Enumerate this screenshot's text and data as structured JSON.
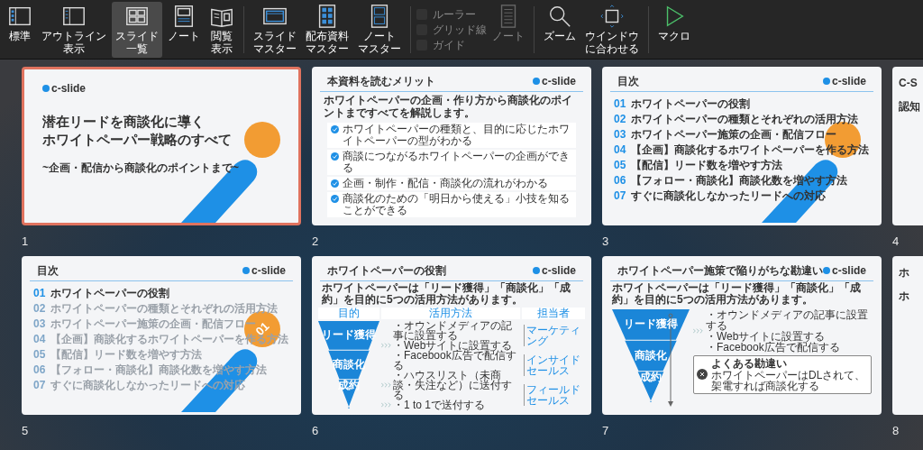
{
  "toolbar": {
    "groups": [
      {
        "items": [
          {
            "kind": "normal",
            "label": [
              "標準"
            ],
            "selected": false
          },
          {
            "kind": "outline",
            "label": [
              "アウトライン",
              "表示"
            ],
            "selected": false
          },
          {
            "kind": "sorter",
            "label": [
              "スライド",
              "一覧"
            ],
            "selected": true
          },
          {
            "kind": "notes",
            "label": [
              "ノート"
            ],
            "selected": false
          },
          {
            "kind": "reading",
            "label": [
              "閲覧",
              "表示"
            ],
            "selected": false
          }
        ]
      },
      {
        "items": [
          {
            "kind": "slide_master",
            "label": [
              "スライド",
              "マスター"
            ]
          },
          {
            "kind": "handout_master",
            "label": [
              "配布資料",
              "マスター"
            ]
          },
          {
            "kind": "notes_master",
            "label": [
              "ノート",
              "マスター"
            ]
          }
        ]
      },
      {
        "items": [
          {
            "kind": "checkboxes",
            "options": [
              {
                "label": "ルーラー",
                "checked": false,
                "disabled": true
              },
              {
                "label": "グリッド線",
                "checked": false,
                "disabled": true
              },
              {
                "label": "ガイド",
                "checked": false,
                "disabled": true
              }
            ]
          },
          {
            "kind": "notes_page",
            "label": [
              "ノート"
            ],
            "disabled": true
          }
        ]
      },
      {
        "items": [
          {
            "kind": "zoom",
            "label": [
              "ズーム"
            ]
          },
          {
            "kind": "fit",
            "label": [
              "ウインドウ",
              "に合わせる"
            ]
          }
        ]
      },
      {
        "items": [
          {
            "kind": "macro",
            "label": [
              "マクロ"
            ]
          }
        ]
      }
    ]
  },
  "slides": [
    {
      "number": "1",
      "selected": true,
      "kind": "title",
      "logo": "c-slide",
      "title": [
        "潜在リードを商談化に導く",
        "ホワイトペーパー戦略のすべて"
      ],
      "subtitle": "~企画・配信から商談化のポイントまで~"
    },
    {
      "number": "2",
      "selected": false,
      "kind": "benefits",
      "title": "本資料を読むメリット",
      "logo": "c-slide",
      "lead": "ホワイトペーパーの企画・作り方から商談化のポイントまですべてを解説します。",
      "points": [
        "ホワイトペーパーの種類と、目的に応じたホワイトペーパーの型がわかる",
        "商談につながるホワイトペーパーの企画ができる",
        "企画・制作・配信・商談化の流れがわかる",
        "商談化のための「明日から使える」小技を知ることができる"
      ]
    },
    {
      "number": "3",
      "selected": false,
      "kind": "toc",
      "title": "目次",
      "logo": "c-slide",
      "items": [
        {
          "num": "01",
          "text": "ホワイトペーパーの役割",
          "active": true
        },
        {
          "num": "02",
          "text": "ホワイトペーパーの種類とそれぞれの活用方法",
          "active": true
        },
        {
          "num": "03",
          "text": "ホワイトペーパー施策の企画・配信フロー",
          "active": true
        },
        {
          "num": "04",
          "text": "【企画】商談化するホワイトペーパーを作る方法",
          "active": true
        },
        {
          "num": "05",
          "text": "【配信】リード数を増やす方法",
          "active": true
        },
        {
          "num": "06",
          "text": "【フォロー・商談化】商談化数を増やす方法",
          "active": true
        },
        {
          "num": "07",
          "text": "すぐに商談化しなかったリードへの対応",
          "active": true
        }
      ]
    },
    {
      "number": "4",
      "selected": false,
      "kind": "partial",
      "title": "C-S",
      "lead": "認知"
    },
    {
      "number": "5",
      "selected": false,
      "kind": "toc",
      "title": "目次",
      "logo": "c-slide",
      "badge": "01",
      "items": [
        {
          "num": "01",
          "text": "ホワイトペーパーの役割",
          "active": true
        },
        {
          "num": "02",
          "text": "ホワイトペーパーの種類とそれぞれの活用方法",
          "active": false
        },
        {
          "num": "03",
          "text": "ホワイトペーパー施策の企画・配信フロー",
          "active": false
        },
        {
          "num": "04",
          "text": "【企画】商談化するホワイトペーパーを作る方法",
          "active": false
        },
        {
          "num": "05",
          "text": "【配信】リード数を増やす方法",
          "active": false
        },
        {
          "num": "06",
          "text": "【フォロー・商談化】商談化数を増やす方法",
          "active": false
        },
        {
          "num": "07",
          "text": "すぐに商談化しなかったリードへの対応",
          "active": false
        }
      ]
    },
    {
      "number": "6",
      "selected": false,
      "kind": "funnel",
      "title": "ホワイトペーパーの役割",
      "logo": "c-slide",
      "lead": "ホワイトペーパーは「リード獲得」「商談化」「成約」を目的に5つの活用方法があります。",
      "headers": [
        "目的",
        "活用方法",
        "担当者"
      ],
      "levels": [
        "リード獲得",
        "商談化",
        "成約"
      ],
      "methods": [
        [
          "・オウンドメディアの記事に設置する",
          "・Webサイトに設置する",
          "・Facebook広告で配信する"
        ],
        [
          "・ハウスリスト（未商談・失注など）に送付する"
        ],
        [
          "・1 to 1で送付する"
        ]
      ],
      "owners": [
        "マーケティング",
        "インサイドセールス",
        "フィールドセールス"
      ]
    },
    {
      "number": "7",
      "selected": false,
      "kind": "misconception",
      "title": "ホワイトペーパー施策で陥りがちな勘違い",
      "logo": "c-slide",
      "lead": "ホワイトペーパーは「リード獲得」「商談化」「成約」を目的に5つの活用方法があります。",
      "levels": [
        "リード獲得",
        "商談化",
        "成約"
      ],
      "methods": [
        "・オウンドメディアの記事に設置する",
        "・Webサイトに設置する",
        "・Facebook広告で配信する"
      ],
      "callout": {
        "title": "よくある勘違い",
        "text": "ホワイトペーパーはDLされて、架電すれば商談化する"
      }
    },
    {
      "number": "8",
      "selected": false,
      "kind": "partial",
      "title": "ホ",
      "lead": "ホ"
    }
  ]
}
